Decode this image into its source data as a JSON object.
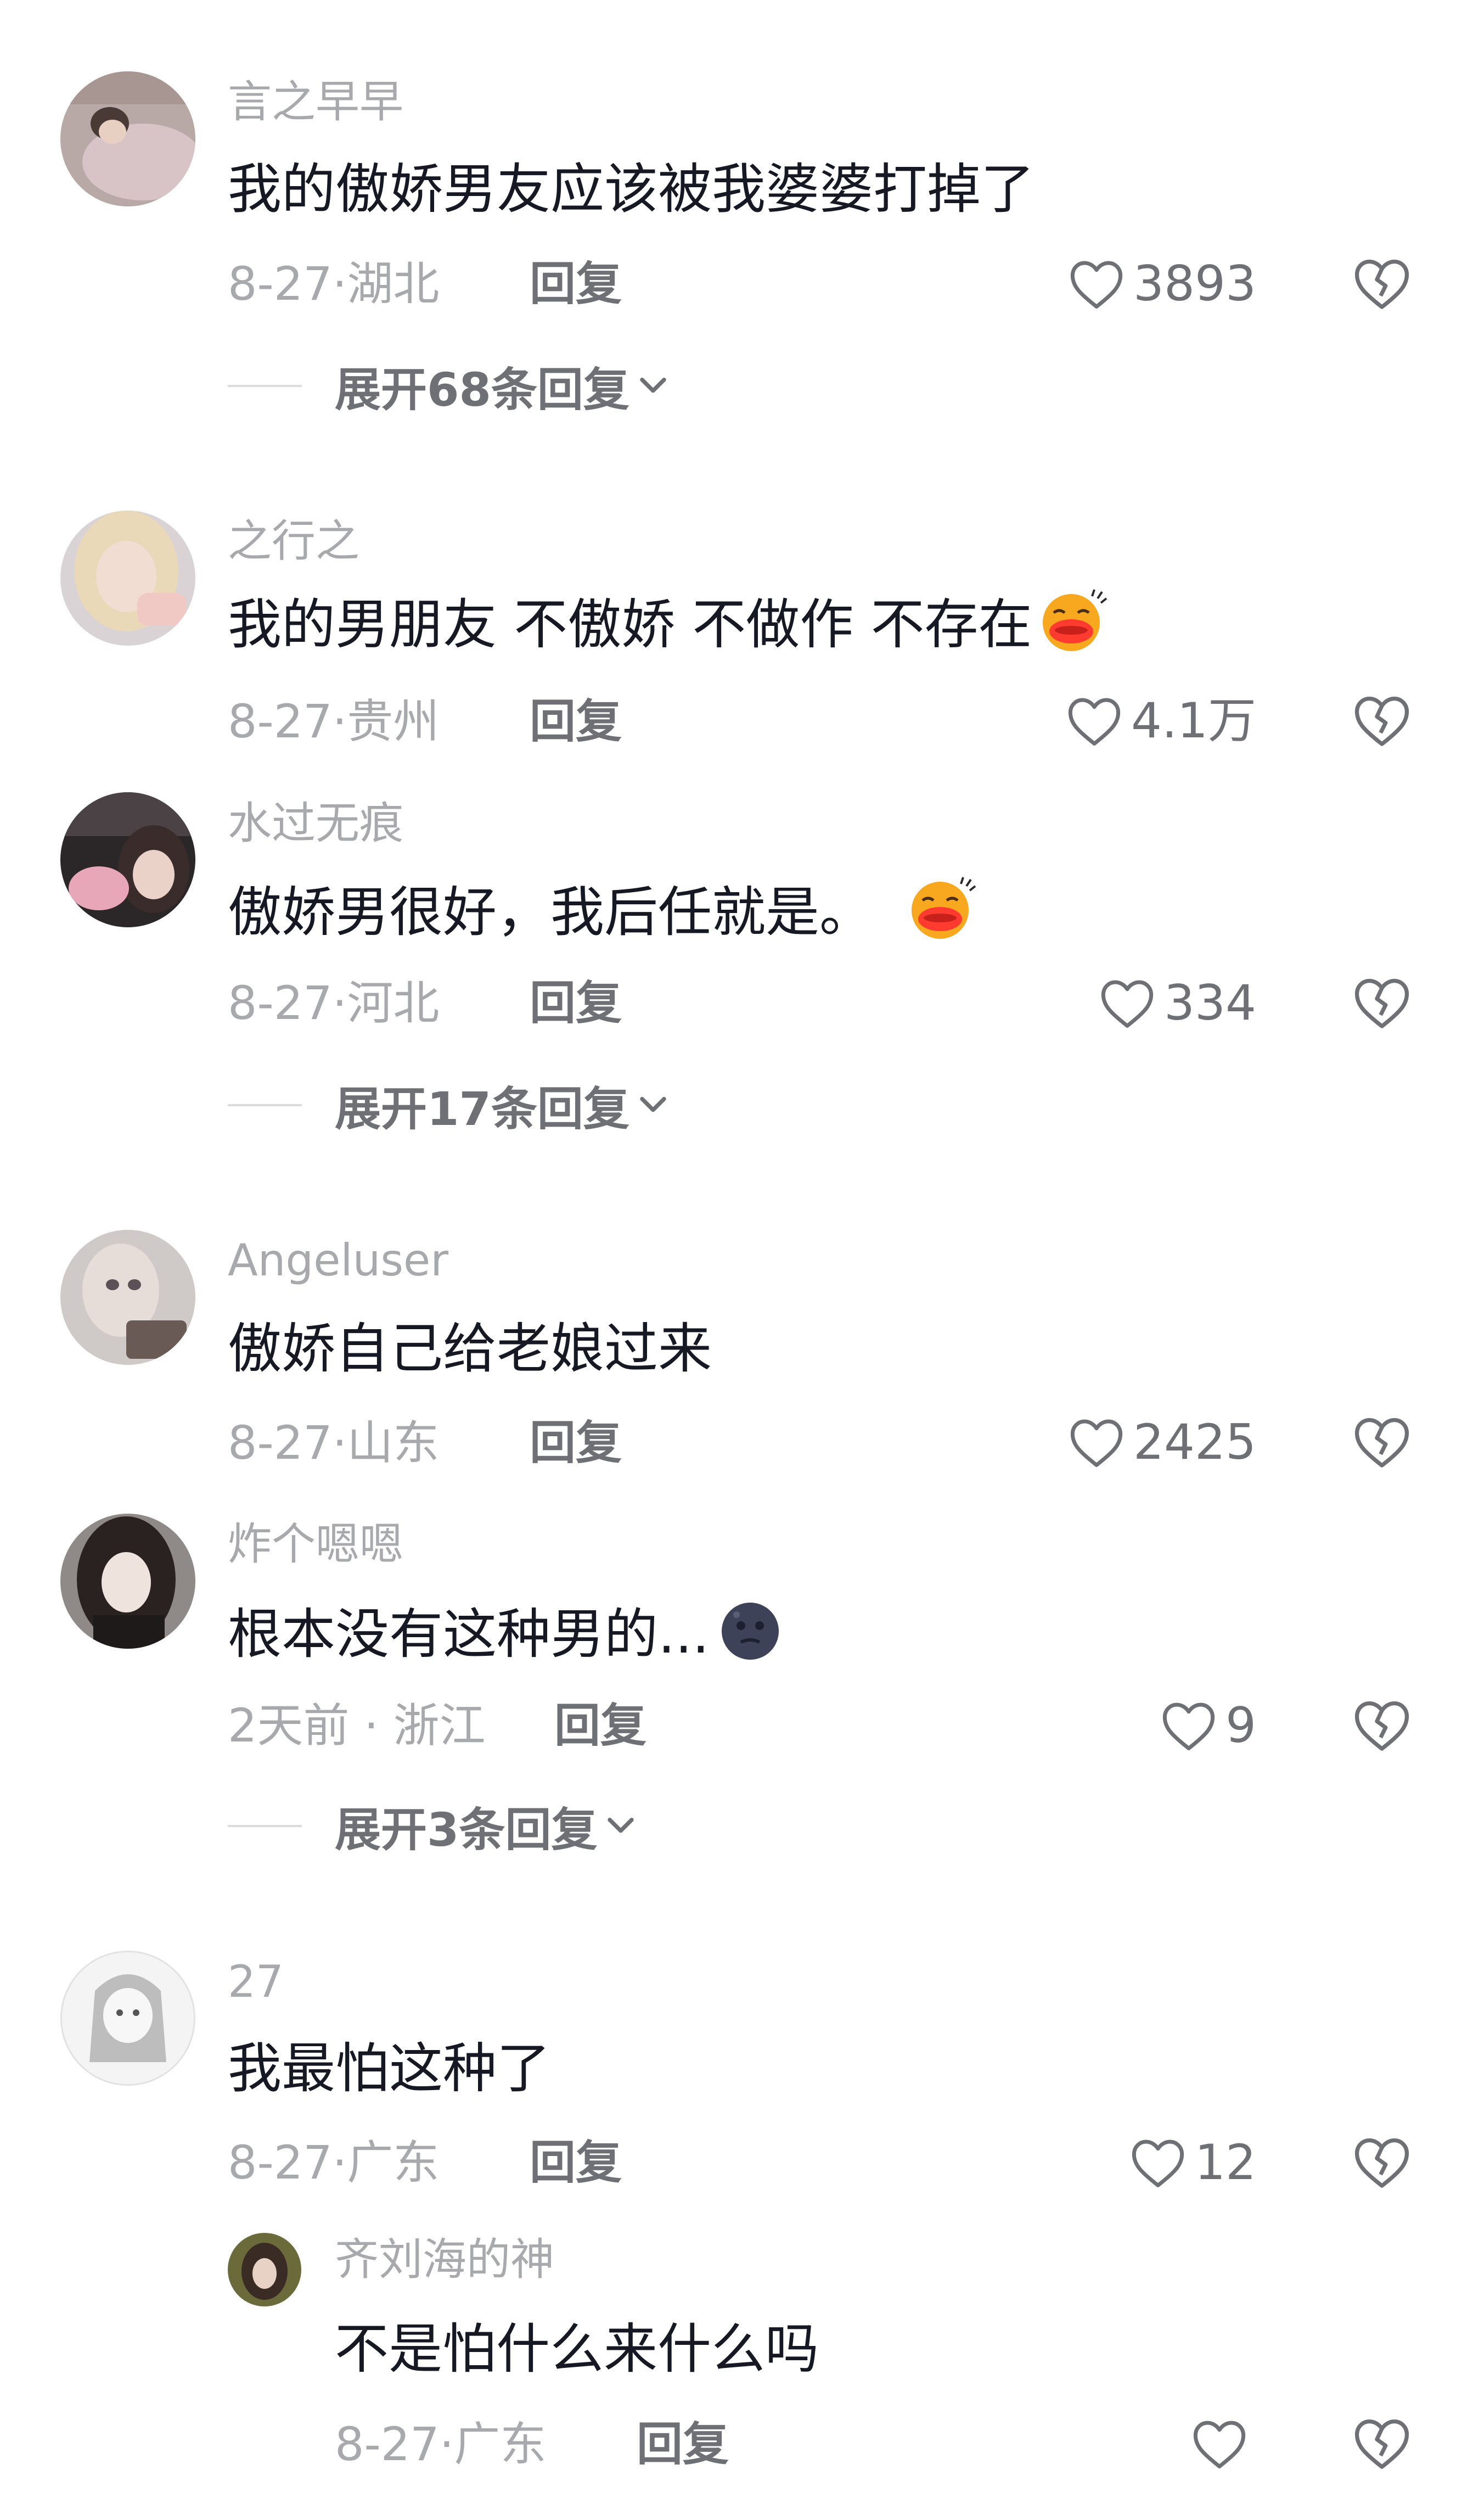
{
  "comments": [
    {
      "username": "言之早早",
      "text": "我的傲娇男友应该被我婆婆打掉了",
      "date_region": "8-27·湖北",
      "reply_label": "回复",
      "likes": "3893",
      "avatar_icon": "avatar-sleeping-girl",
      "expand_text": "展开68条回复",
      "emoji": ""
    },
    {
      "username": "之行之",
      "text": "我的男朋友 不傲娇 不做作 不存在",
      "date_region": "8-27·贵州",
      "reply_label": "回复",
      "likes": "4.1万",
      "avatar_icon": "avatar-blonde-girl",
      "emoji": "blushing-lips-emoji"
    },
    {
      "username": "水过无痕",
      "text": "傲娇男很好，我后任就是。",
      "date_region": "8-27·河北",
      "reply_label": "回复",
      "likes": "334",
      "avatar_icon": "avatar-girl-with-plush",
      "expand_text": "展开17条回复",
      "emoji": "blushing-lips-emoji"
    },
    {
      "username": "Angeluser",
      "text": "傲娇自己给老娘过来",
      "date_region": "8-27·山东",
      "reply_label": "回复",
      "likes": "2425",
      "avatar_icon": "avatar-doll",
      "emoji": ""
    },
    {
      "username": "炸个嗯嗯",
      "text": "根本没有这种男的...",
      "date_region": "2天前 · 浙江",
      "reply_label": "回复",
      "likes": "9",
      "avatar_icon": "avatar-dark-hair-girl",
      "expand_text": "展开3条回复",
      "emoji": "dark-moon-face-emoji"
    },
    {
      "username": "27",
      "text": "我最怕这种了",
      "date_region": "8-27·广东",
      "reply_label": "回复",
      "likes": "12",
      "avatar_icon": "avatar-anime-sketch",
      "emoji": ""
    }
  ],
  "nested_reply": {
    "username": "齐刘海的神",
    "text": "不是怕什么来什么吗",
    "date_region": "8-27·广东",
    "reply_label": "回复",
    "likes": "",
    "avatar_icon": "avatar-small-girl"
  },
  "colors": {
    "meta_gray": "#a8a9ad",
    "text_dark": "#161823",
    "action_gray": "#6f7075",
    "divider": "#dcdcde"
  }
}
